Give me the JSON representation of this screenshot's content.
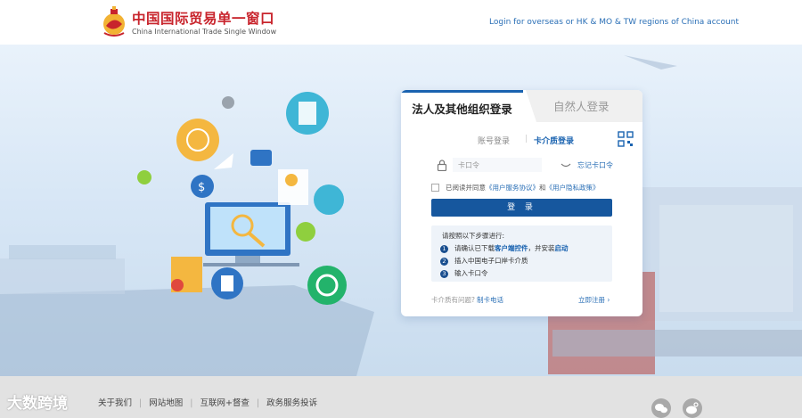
{
  "header": {
    "logo_cn": "中国国际贸易单一窗口",
    "logo_en": "China International Trade Single Window",
    "overseas_login": "Login for overseas or HK & MO & TW regions of China account"
  },
  "login": {
    "tab_legal": "法人及其他组织登录",
    "tab_natural": "自然人登录",
    "subtab_account": "账号登录",
    "subtab_card": "卡介质登录",
    "pin_placeholder": "卡口令",
    "forgot_pin": "忘记卡口令",
    "agree_prefix": "已阅读并同意",
    "agree_service": "《用户服务协议》",
    "agree_and": "和",
    "agree_privacy": "《用户隐私政策》",
    "login_button": "登 录",
    "steps_title": "请按照以下步骤进行:",
    "steps": [
      {
        "num": "1",
        "pre": "请确认已下载",
        "link1": "客户端控件",
        "mid": "，并安装",
        "link2": "启动"
      },
      {
        "num": "2",
        "text": "插入中国电子口岸卡介质"
      },
      {
        "num": "3",
        "text": "输入卡口令"
      }
    ],
    "card_question": "卡介质有问题?",
    "card_phone": "制卡电话",
    "register": "立即注册 ›"
  },
  "footer": {
    "links": [
      "关于我们",
      "网站地图",
      "互联网+督查",
      "政务服务投诉"
    ],
    "watermark": "大数跨境"
  },
  "colors": {
    "brand_red": "#c8242c",
    "primary_blue": "#16579e",
    "link_blue": "#2a6fb6"
  }
}
